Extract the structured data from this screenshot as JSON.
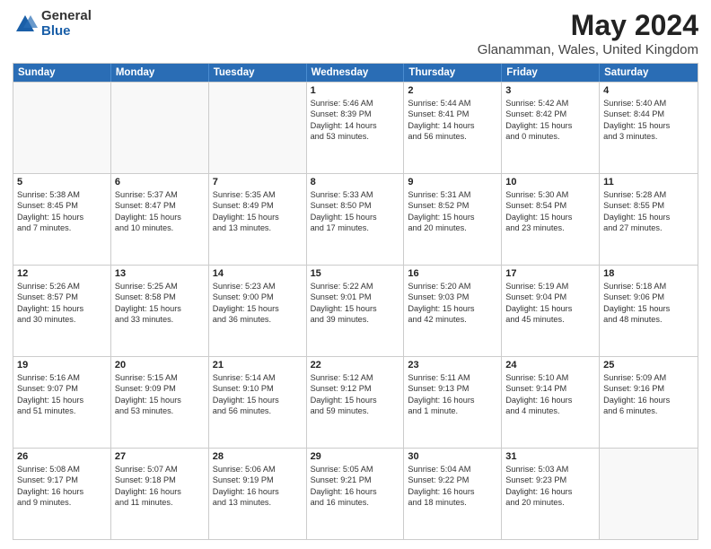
{
  "logo": {
    "general": "General",
    "blue": "Blue"
  },
  "title": {
    "month": "May 2024",
    "location": "Glanamman, Wales, United Kingdom"
  },
  "header_days": [
    "Sunday",
    "Monday",
    "Tuesday",
    "Wednesday",
    "Thursday",
    "Friday",
    "Saturday"
  ],
  "weeks": [
    [
      {
        "day": "",
        "lines": []
      },
      {
        "day": "",
        "lines": []
      },
      {
        "day": "",
        "lines": []
      },
      {
        "day": "1",
        "lines": [
          "Sunrise: 5:46 AM",
          "Sunset: 8:39 PM",
          "Daylight: 14 hours",
          "and 53 minutes."
        ]
      },
      {
        "day": "2",
        "lines": [
          "Sunrise: 5:44 AM",
          "Sunset: 8:41 PM",
          "Daylight: 14 hours",
          "and 56 minutes."
        ]
      },
      {
        "day": "3",
        "lines": [
          "Sunrise: 5:42 AM",
          "Sunset: 8:42 PM",
          "Daylight: 15 hours",
          "and 0 minutes."
        ]
      },
      {
        "day": "4",
        "lines": [
          "Sunrise: 5:40 AM",
          "Sunset: 8:44 PM",
          "Daylight: 15 hours",
          "and 3 minutes."
        ]
      }
    ],
    [
      {
        "day": "5",
        "lines": [
          "Sunrise: 5:38 AM",
          "Sunset: 8:45 PM",
          "Daylight: 15 hours",
          "and 7 minutes."
        ]
      },
      {
        "day": "6",
        "lines": [
          "Sunrise: 5:37 AM",
          "Sunset: 8:47 PM",
          "Daylight: 15 hours",
          "and 10 minutes."
        ]
      },
      {
        "day": "7",
        "lines": [
          "Sunrise: 5:35 AM",
          "Sunset: 8:49 PM",
          "Daylight: 15 hours",
          "and 13 minutes."
        ]
      },
      {
        "day": "8",
        "lines": [
          "Sunrise: 5:33 AM",
          "Sunset: 8:50 PM",
          "Daylight: 15 hours",
          "and 17 minutes."
        ]
      },
      {
        "day": "9",
        "lines": [
          "Sunrise: 5:31 AM",
          "Sunset: 8:52 PM",
          "Daylight: 15 hours",
          "and 20 minutes."
        ]
      },
      {
        "day": "10",
        "lines": [
          "Sunrise: 5:30 AM",
          "Sunset: 8:54 PM",
          "Daylight: 15 hours",
          "and 23 minutes."
        ]
      },
      {
        "day": "11",
        "lines": [
          "Sunrise: 5:28 AM",
          "Sunset: 8:55 PM",
          "Daylight: 15 hours",
          "and 27 minutes."
        ]
      }
    ],
    [
      {
        "day": "12",
        "lines": [
          "Sunrise: 5:26 AM",
          "Sunset: 8:57 PM",
          "Daylight: 15 hours",
          "and 30 minutes."
        ]
      },
      {
        "day": "13",
        "lines": [
          "Sunrise: 5:25 AM",
          "Sunset: 8:58 PM",
          "Daylight: 15 hours",
          "and 33 minutes."
        ]
      },
      {
        "day": "14",
        "lines": [
          "Sunrise: 5:23 AM",
          "Sunset: 9:00 PM",
          "Daylight: 15 hours",
          "and 36 minutes."
        ]
      },
      {
        "day": "15",
        "lines": [
          "Sunrise: 5:22 AM",
          "Sunset: 9:01 PM",
          "Daylight: 15 hours",
          "and 39 minutes."
        ]
      },
      {
        "day": "16",
        "lines": [
          "Sunrise: 5:20 AM",
          "Sunset: 9:03 PM",
          "Daylight: 15 hours",
          "and 42 minutes."
        ]
      },
      {
        "day": "17",
        "lines": [
          "Sunrise: 5:19 AM",
          "Sunset: 9:04 PM",
          "Daylight: 15 hours",
          "and 45 minutes."
        ]
      },
      {
        "day": "18",
        "lines": [
          "Sunrise: 5:18 AM",
          "Sunset: 9:06 PM",
          "Daylight: 15 hours",
          "and 48 minutes."
        ]
      }
    ],
    [
      {
        "day": "19",
        "lines": [
          "Sunrise: 5:16 AM",
          "Sunset: 9:07 PM",
          "Daylight: 15 hours",
          "and 51 minutes."
        ]
      },
      {
        "day": "20",
        "lines": [
          "Sunrise: 5:15 AM",
          "Sunset: 9:09 PM",
          "Daylight: 15 hours",
          "and 53 minutes."
        ]
      },
      {
        "day": "21",
        "lines": [
          "Sunrise: 5:14 AM",
          "Sunset: 9:10 PM",
          "Daylight: 15 hours",
          "and 56 minutes."
        ]
      },
      {
        "day": "22",
        "lines": [
          "Sunrise: 5:12 AM",
          "Sunset: 9:12 PM",
          "Daylight: 15 hours",
          "and 59 minutes."
        ]
      },
      {
        "day": "23",
        "lines": [
          "Sunrise: 5:11 AM",
          "Sunset: 9:13 PM",
          "Daylight: 16 hours",
          "and 1 minute."
        ]
      },
      {
        "day": "24",
        "lines": [
          "Sunrise: 5:10 AM",
          "Sunset: 9:14 PM",
          "Daylight: 16 hours",
          "and 4 minutes."
        ]
      },
      {
        "day": "25",
        "lines": [
          "Sunrise: 5:09 AM",
          "Sunset: 9:16 PM",
          "Daylight: 16 hours",
          "and 6 minutes."
        ]
      }
    ],
    [
      {
        "day": "26",
        "lines": [
          "Sunrise: 5:08 AM",
          "Sunset: 9:17 PM",
          "Daylight: 16 hours",
          "and 9 minutes."
        ]
      },
      {
        "day": "27",
        "lines": [
          "Sunrise: 5:07 AM",
          "Sunset: 9:18 PM",
          "Daylight: 16 hours",
          "and 11 minutes."
        ]
      },
      {
        "day": "28",
        "lines": [
          "Sunrise: 5:06 AM",
          "Sunset: 9:19 PM",
          "Daylight: 16 hours",
          "and 13 minutes."
        ]
      },
      {
        "day": "29",
        "lines": [
          "Sunrise: 5:05 AM",
          "Sunset: 9:21 PM",
          "Daylight: 16 hours",
          "and 16 minutes."
        ]
      },
      {
        "day": "30",
        "lines": [
          "Sunrise: 5:04 AM",
          "Sunset: 9:22 PM",
          "Daylight: 16 hours",
          "and 18 minutes."
        ]
      },
      {
        "day": "31",
        "lines": [
          "Sunrise: 5:03 AM",
          "Sunset: 9:23 PM",
          "Daylight: 16 hours",
          "and 20 minutes."
        ]
      },
      {
        "day": "",
        "lines": []
      }
    ]
  ]
}
